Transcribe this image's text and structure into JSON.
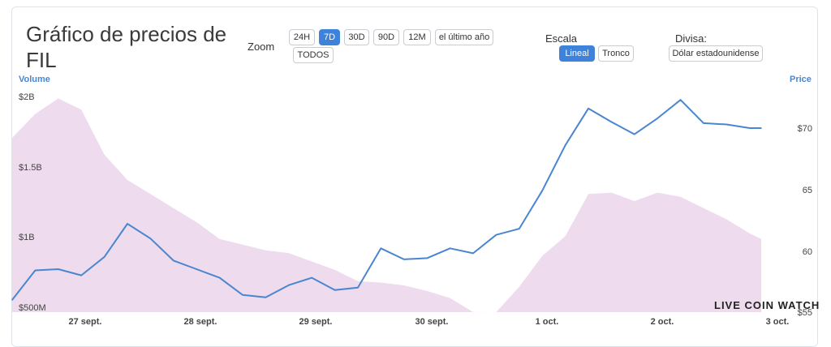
{
  "title": "Gráfico de precios de FIL",
  "controls": {
    "zoom_label": "Zoom",
    "zoom_options": [
      "24H",
      "7D",
      "30D",
      "90D",
      "12M",
      "el último año",
      "TODOS"
    ],
    "zoom_selected": "7D",
    "scale_label": "Escala",
    "scale_options": [
      "Lineal",
      "Tronco"
    ],
    "scale_selected": "Lineal",
    "currency_label": "Divisa:",
    "currency_value": "Dólar estadounidense"
  },
  "watermark": "LIVE COIN WATCH",
  "colors": {
    "price_line": "#4a86cf",
    "volume_fill": "#eedcee",
    "accent": "#3f82d9"
  },
  "chart_data": {
    "type": "line",
    "left_axis_title": "Volume",
    "right_axis_title": "Price",
    "x_ticks": [
      "27 sept.",
      "28 sept.",
      "29 sept.",
      "30 sept.",
      "1 oct.",
      "2 oct.",
      "3 oct."
    ],
    "y_left_ticks": [
      "$500M",
      "$1B",
      "$1.5B",
      "$2B"
    ],
    "y_right_ticks": [
      "$55",
      "60",
      "65",
      "$70"
    ],
    "ylim_left": [
      500000000,
      2000000000
    ],
    "ylim_right": [
      55,
      70
    ],
    "grid": false,
    "series": [
      {
        "name": "Price",
        "axis": "right",
        "x": [
          0,
          0.2,
          0.4,
          0.6,
          0.8,
          1.0,
          1.2,
          1.4,
          1.6,
          1.8,
          2.0,
          2.2,
          2.4,
          2.6,
          2.8,
          3.0,
          3.2,
          3.4,
          3.6,
          3.8,
          4.0,
          4.2,
          4.4,
          4.6,
          4.8,
          5.0,
          5.2,
          5.4,
          5.6,
          5.8,
          6.0,
          6.2,
          6.4,
          6.5
        ],
        "y": [
          56.0,
          58.4,
          58.5,
          58.0,
          59.5,
          62.2,
          61.0,
          59.2,
          58.5,
          57.8,
          56.4,
          56.2,
          57.2,
          57.8,
          56.8,
          57.0,
          60.2,
          59.3,
          59.4,
          60.2,
          59.8,
          61.3,
          61.8,
          64.9,
          68.6,
          71.6,
          70.5,
          69.5,
          70.8,
          72.3,
          70.4,
          70.3,
          70.0,
          70.0
        ]
      },
      {
        "name": "Volume",
        "axis": "left",
        "x": [
          0,
          0.2,
          0.4,
          0.6,
          0.8,
          1.0,
          1.2,
          1.4,
          1.6,
          1.8,
          2.0,
          2.2,
          2.4,
          2.6,
          2.8,
          3.0,
          3.2,
          3.4,
          3.6,
          3.8,
          4.0,
          4.2,
          4.4,
          4.6,
          4.8,
          5.0,
          5.2,
          5.4,
          5.6,
          5.8,
          6.0,
          6.2,
          6.4,
          6.5
        ],
        "y": [
          1700000000,
          1870000000,
          1980000000,
          1900000000,
          1580000000,
          1400000000,
          1300000000,
          1200000000,
          1100000000,
          980000000,
          940000000,
          900000000,
          880000000,
          820000000,
          760000000,
          680000000,
          670000000,
          650000000,
          610000000,
          560000000,
          460000000,
          400000000,
          640000000,
          860000000,
          1000000000,
          1300000000,
          1310000000,
          1250000000,
          1310000000,
          1280000000,
          1200000000,
          1120000000,
          1020000000,
          980000000
        ]
      }
    ]
  }
}
